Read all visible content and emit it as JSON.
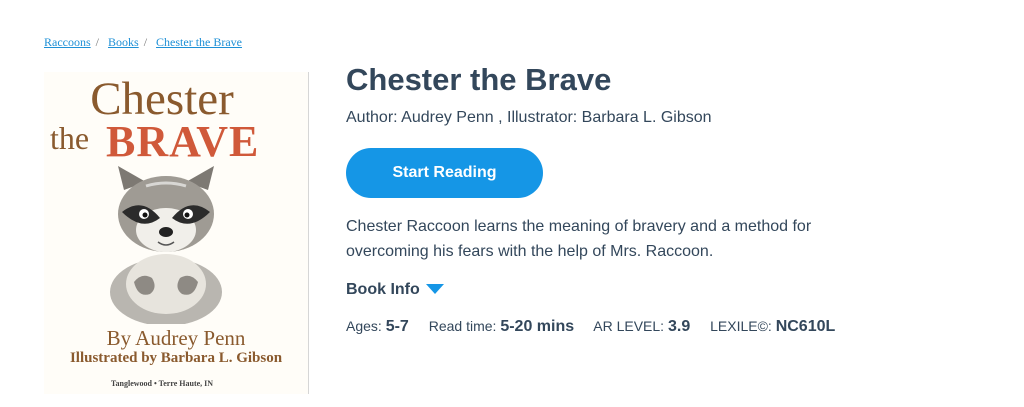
{
  "breadcrumb": [
    "Raccoons",
    "Books",
    "Chester the Brave"
  ],
  "cover": {
    "title_line1": "Chester",
    "title_line2a": "the",
    "title_line2b": "BRAVE",
    "by_line": "By Audrey Penn",
    "illustrated_line": "Illustrated by Barbara L. Gibson",
    "publisher": "Tanglewood • Terre Haute, IN"
  },
  "book": {
    "title": "Chester the Brave",
    "authors": "Author: Audrey Penn , Illustrator: Barbara L. Gibson",
    "start_button": "Start Reading",
    "description": "Chester Raccoon learns the meaning of bravery and a method for overcoming his fears with the help of Mrs. Raccoon.",
    "book_info_label": "Book Info"
  },
  "meta": {
    "ages_label": "Ages:",
    "ages_value": "5-7",
    "read_label": "Read time:",
    "read_value": "5-20 mins",
    "ar_label": "AR LEVEL:",
    "ar_value": "3.9",
    "lexile_label": "LEXILE©:",
    "lexile_value": "NC610L"
  },
  "colors": {
    "accent": "#1596e6",
    "text": "#33475b",
    "cover_brown": "#8a5a2e",
    "cover_red": "#d0593a"
  }
}
